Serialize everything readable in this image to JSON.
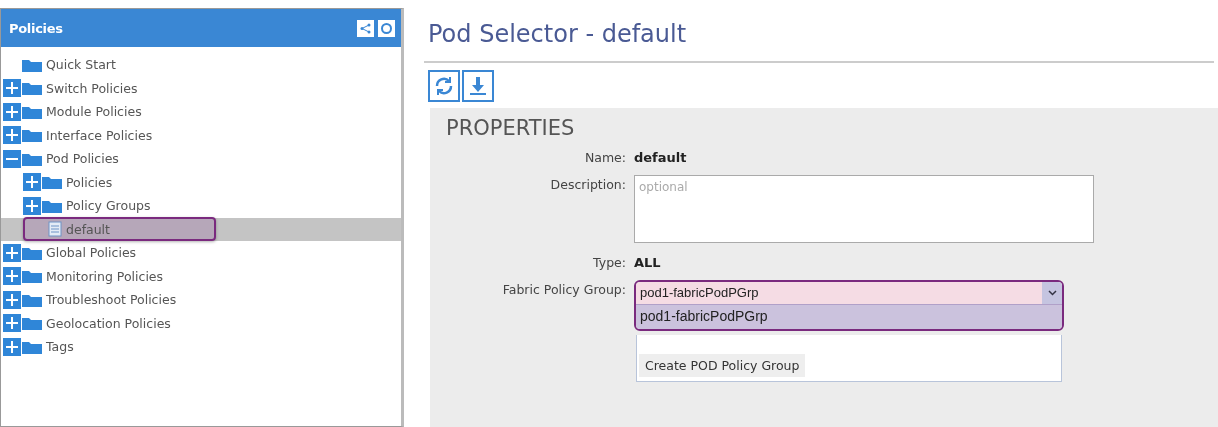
{
  "sidebar": {
    "title": "Policies",
    "items": [
      {
        "label": "Quick Start",
        "kind": "folder",
        "selected": false
      },
      {
        "label": "Switch Policies",
        "kind": "group",
        "expanded": false,
        "selected": false
      },
      {
        "label": "Module Policies",
        "kind": "group",
        "expanded": false,
        "selected": false
      },
      {
        "label": "Interface Policies",
        "kind": "group",
        "expanded": false,
        "selected": false
      },
      {
        "label": "Pod Policies",
        "kind": "group",
        "expanded": true,
        "selected": false,
        "children": [
          {
            "label": "Policies",
            "kind": "group",
            "expanded": false,
            "selected": false
          },
          {
            "label": "Policy Groups",
            "kind": "group",
            "expanded": false,
            "selected": false
          },
          {
            "label": "default",
            "kind": "entry",
            "selected": true
          }
        ]
      },
      {
        "label": "Global Policies",
        "kind": "group",
        "expanded": false,
        "selected": false
      },
      {
        "label": "Monitoring Policies",
        "kind": "group",
        "expanded": false,
        "selected": false
      },
      {
        "label": "Troubleshoot Policies",
        "kind": "group",
        "expanded": false,
        "selected": false
      },
      {
        "label": "Geolocation Policies",
        "kind": "group",
        "expanded": false,
        "selected": false
      },
      {
        "label": "Tags",
        "kind": "group",
        "expanded": false,
        "selected": false
      }
    ]
  },
  "main": {
    "title": "Pod Selector - default",
    "properties": {
      "heading": "PROPERTIES",
      "name": {
        "label": "Name:",
        "value": "default"
      },
      "description": {
        "label": "Description:",
        "placeholder": "optional"
      },
      "type": {
        "label": "Type:",
        "value": "ALL"
      },
      "fabric_policy_group": {
        "label": "Fabric Policy Group:",
        "value": "pod1-fabricPodPGrp",
        "options": [
          {
            "label": "pod1-fabricPodPGrp",
            "selected": true
          }
        ],
        "action": "Create POD Policy Group"
      }
    }
  }
}
